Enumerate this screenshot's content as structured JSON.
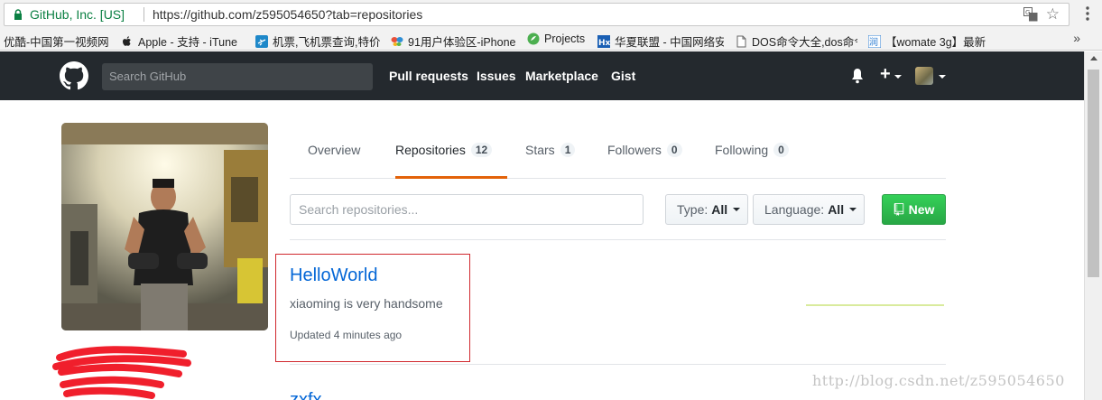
{
  "browser": {
    "site_identity": "GitHub, Inc. [US]",
    "url": "https://github.com/z595054650?tab=repositories",
    "bookmarks": [
      {
        "label": "优酷-中国第一视频网",
        "icon": "youku-icon"
      },
      {
        "label": "Apple - 支持 - iTune",
        "icon": "apple-icon"
      },
      {
        "label": "机票,飞机票查询,特价",
        "icon": "flight-icon"
      },
      {
        "label": "91用户体验区-iPhone",
        "icon": "butterfly-icon"
      },
      {
        "label": "Projects",
        "icon": "projects-icon"
      },
      {
        "label": "华夏联盟 - 中国网络安",
        "icon": "hx-icon"
      },
      {
        "label": "DOS命令大全,dos命令",
        "icon": "page-icon"
      },
      {
        "label": "【womate 3g】最新",
        "icon": "womate-icon"
      }
    ],
    "more_bookmarks": "»"
  },
  "header": {
    "search_placeholder": "Search GitHub",
    "nav": [
      "Pull requests",
      "Issues",
      "Marketplace",
      "Gist"
    ],
    "plus": "+"
  },
  "tabs": [
    {
      "label": "Overview",
      "count": null
    },
    {
      "label": "Repositories",
      "count": "12"
    },
    {
      "label": "Stars",
      "count": "1"
    },
    {
      "label": "Followers",
      "count": "0"
    },
    {
      "label": "Following",
      "count": "0"
    }
  ],
  "filters": {
    "search_placeholder": "Search repositories...",
    "type_label": "Type:",
    "type_value": "All",
    "language_label": "Language:",
    "language_value": "All",
    "new_label": "New"
  },
  "repos": [
    {
      "name": "HelloWorld",
      "description": "xiaoming is very handsome",
      "updated": "Updated 4 minutes ago"
    },
    {
      "name": "zxfx"
    }
  ],
  "watermark": "http://blog.csdn.net/z595054650",
  "colors": {
    "accent_orange": "#e36209",
    "link_blue": "#0366d6",
    "new_green": "#28a745",
    "header_bg": "#24292e",
    "highlight_red": "#d0282e"
  }
}
